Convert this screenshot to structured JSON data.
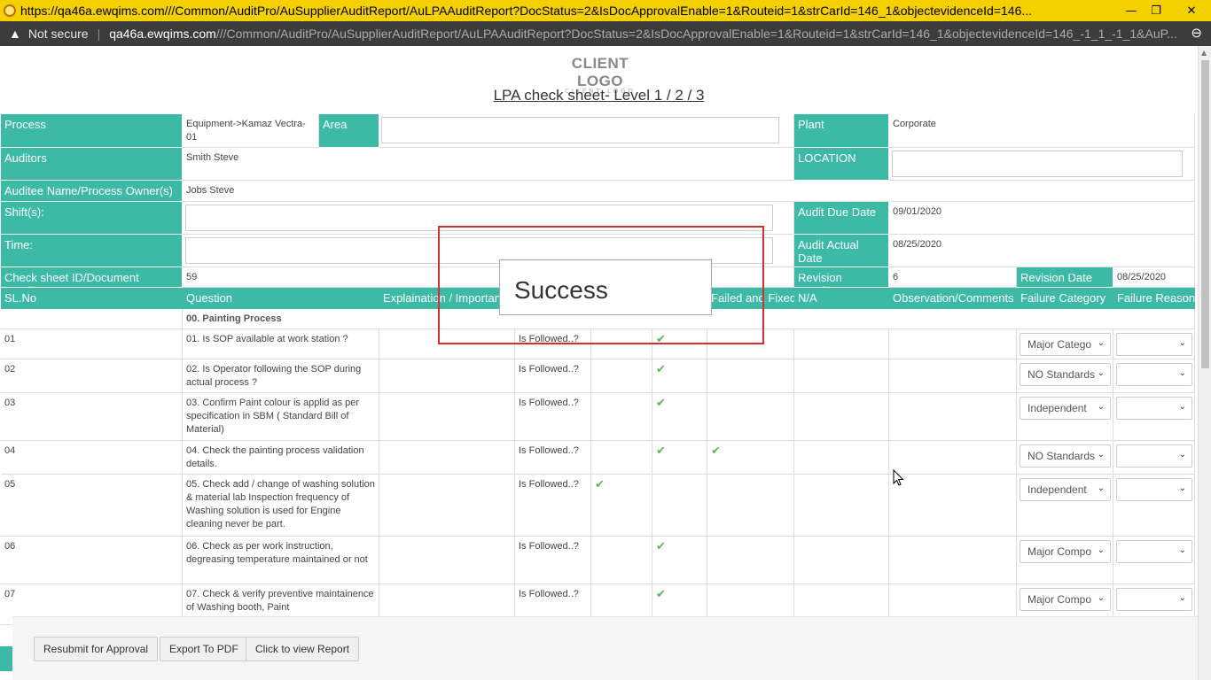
{
  "window": {
    "title": "https://qa46a.ewqims.com///Common/AuditPro/AuSupplierAuditReport/AuLPAAuditReport?DocStatus=2&IsDocApprovalEnable=1&Routeid=1&strCarId=146_1&objectevidenceId=146...",
    "minimize": "—",
    "restore": "❐",
    "close": "✕"
  },
  "address": {
    "warning": "▲",
    "not_secure": "Not secure",
    "host": "qa46a.ewqims.com",
    "path": "///Common/AuditPro/AuSupplierAuditReport/AuLPAAuditReport?DocStatus=2&IsDocApprovalEnable=1&Routeid=1&strCarId=146_1&objectevidenceId=146_-1_1_-1_1&AuP...",
    "zoom_icon": "⊖"
  },
  "logo": {
    "line1": "CLIENT LOGO",
    "line2": "CLIENT LOGO"
  },
  "sheet_title": "LPA check sheet- Level 1 / 2 / 3",
  "info": {
    "process_label": "Process",
    "process_value": "Equipment->Kamaz Vectra-01",
    "area_label": "Area",
    "plant_label": "Plant",
    "plant_value": "Corporate",
    "auditors_label": "Auditors",
    "auditors_value": "Smith Steve",
    "location_label": "LOCATION",
    "auditee_label": "Auditee Name/Process Owner(s)",
    "auditee_value": "Jobs Steve",
    "shifts_label": "Shift(s):",
    "due_label": "Audit Due Date",
    "due_value": "09/01/2020",
    "time_label": "Time:",
    "actual_label": "Audit Actual Date",
    "actual_value": "08/25/2020",
    "docnum_label": "Check sheet ID/Document Number",
    "docnum_value": "59",
    "revnum_label": "Revision Number",
    "revnum_value": "6",
    "revdate_label": "Revision Date",
    "revdate_value": "08/25/2020"
  },
  "columns": {
    "slno": "SL.No",
    "question": "Question",
    "explain": "Explaination / Importance",
    "failed_fixed": "Failed and Fixed",
    "na": "N/A",
    "obs": "Observation/Comments",
    "fail_cat": "Failure Category",
    "fail_reason": "Failure Reason"
  },
  "section": "00. Painting Process",
  "rows": [
    {
      "sl": "01",
      "q": "01. Is SOP available at work station ?",
      "method": "Is Followed..?",
      "category": "Major Catego"
    },
    {
      "sl": "02",
      "q": "02. Is Operator following the SOP during actual process ?",
      "method": "Is Followed..?",
      "category": "NO Standards"
    },
    {
      "sl": "03",
      "q": "03. Confirm Paint colour is applid as per specification in SBM ( Standard Bill of Material)",
      "method": "Is Followed..?",
      "category": "Independent"
    },
    {
      "sl": "04",
      "q": "04. Check the painting process validation details.",
      "method": "Is Followed..?",
      "category": "NO Standards"
    },
    {
      "sl": "05",
      "q": "05. Check add / change of washing solution & material lab Inspection frequency of Washing solution is used for Engine cleaning never be part.",
      "method": "Is Followed..?",
      "category": "Independent"
    },
    {
      "sl": "06",
      "q": "06. Check as per work instruction, degreasing temperature maintained or not",
      "method": "Is Followed..?",
      "category": "Major Compo"
    },
    {
      "sl": "07",
      "q": "07. Check & verify preventive maintainence of Washing booth, Paint",
      "method": "Is Followed..?",
      "category": "Major Compo"
    }
  ],
  "check_glyph": "✔",
  "arrow_glyph": "⌄",
  "modal": {
    "text": "Success"
  },
  "buttons": {
    "resubmit": "Resubmit for Approval",
    "export": "Export To PDF",
    "view": "Click to view Report"
  },
  "colors": {
    "teal": "#3dbaa6",
    "titlebar": "#f5d000",
    "highlight": "#d32f2f",
    "check": "#5cb85c"
  }
}
